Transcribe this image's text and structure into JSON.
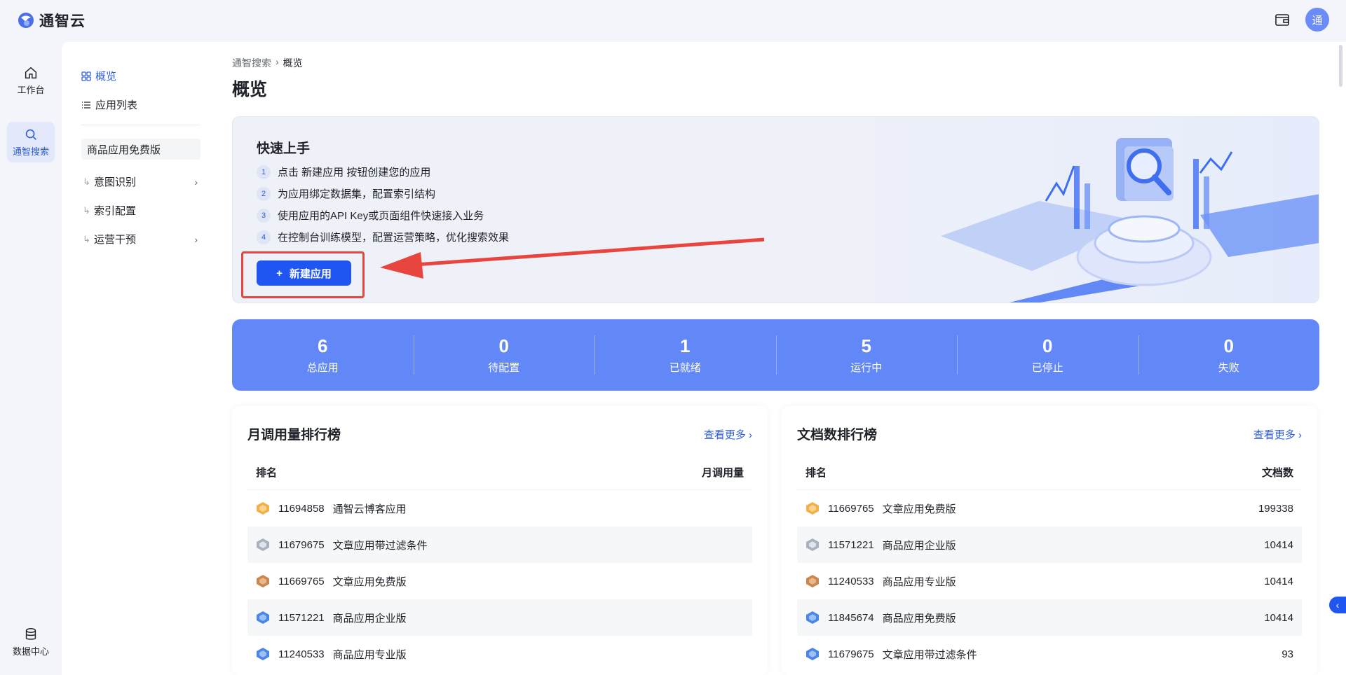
{
  "brand": {
    "name": "通智云",
    "avatar_text": "通"
  },
  "rail": {
    "items": [
      {
        "label": "工作台"
      },
      {
        "label": "通智搜索"
      },
      {
        "label": "数据中心"
      }
    ]
  },
  "subnav": {
    "overview": "概览",
    "app_list": "应用列表",
    "current_app": "商品应用免费版",
    "items": [
      {
        "label": "意图识别"
      },
      {
        "label": "索引配置"
      },
      {
        "label": "运营干预"
      }
    ]
  },
  "breadcrumb": {
    "parent": "通智搜索",
    "current": "概览"
  },
  "page_title": "概览",
  "quickstart": {
    "title": "快速上手",
    "steps": [
      {
        "num": "1",
        "text": "点击 新建应用 按钮创建您的应用"
      },
      {
        "num": "2",
        "text": "为应用绑定数据集，配置索引结构"
      },
      {
        "num": "3",
        "text": "使用应用的API Key或页面组件快速接入业务"
      },
      {
        "num": "4",
        "text": "在控制台训练模型，配置运营策略，优化搜索效果"
      }
    ],
    "button": "新建应用"
  },
  "stats": [
    {
      "value": "6",
      "label": "总应用"
    },
    {
      "value": "0",
      "label": "待配置"
    },
    {
      "value": "1",
      "label": "已就绪"
    },
    {
      "value": "5",
      "label": "运行中"
    },
    {
      "value": "0",
      "label": "已停止"
    },
    {
      "value": "0",
      "label": "失败"
    }
  ],
  "usage_rank": {
    "title": "月调用量排行榜",
    "more": "查看更多",
    "col_rank": "排名",
    "col_value": "月调用量",
    "rows": [
      {
        "id": "11694858",
        "name": "通智云博客应用",
        "value": ""
      },
      {
        "id": "11679675",
        "name": "文章应用带过滤条件",
        "value": ""
      },
      {
        "id": "11669765",
        "name": "文章应用免费版",
        "value": ""
      },
      {
        "id": "11571221",
        "name": "商品应用企业版",
        "value": ""
      },
      {
        "id": "11240533",
        "name": "商品应用专业版",
        "value": ""
      }
    ]
  },
  "doc_rank": {
    "title": "文档数排行榜",
    "more": "查看更多",
    "col_rank": "排名",
    "col_value": "文档数",
    "rows": [
      {
        "id": "11669765",
        "name": "文章应用免费版",
        "value": "199338"
      },
      {
        "id": "11571221",
        "name": "商品应用企业版",
        "value": "10414"
      },
      {
        "id": "11240533",
        "name": "商品应用专业版",
        "value": "10414"
      },
      {
        "id": "11845674",
        "name": "商品应用免费版",
        "value": "10414"
      },
      {
        "id": "11679675",
        "name": "文章应用带过滤条件",
        "value": "93"
      }
    ]
  },
  "colors": {
    "primary": "#1f55f0",
    "stats_bg": "#6287f7",
    "highlight": "#e8453e"
  },
  "icons": [
    "home-icon",
    "search-icon",
    "database-icon",
    "wallet-icon",
    "grid-icon",
    "list-icon",
    "chevron-right-icon",
    "plus-icon",
    "medal-gold-icon",
    "medal-silver-icon",
    "medal-bronze-icon",
    "medal-blue-icon"
  ]
}
